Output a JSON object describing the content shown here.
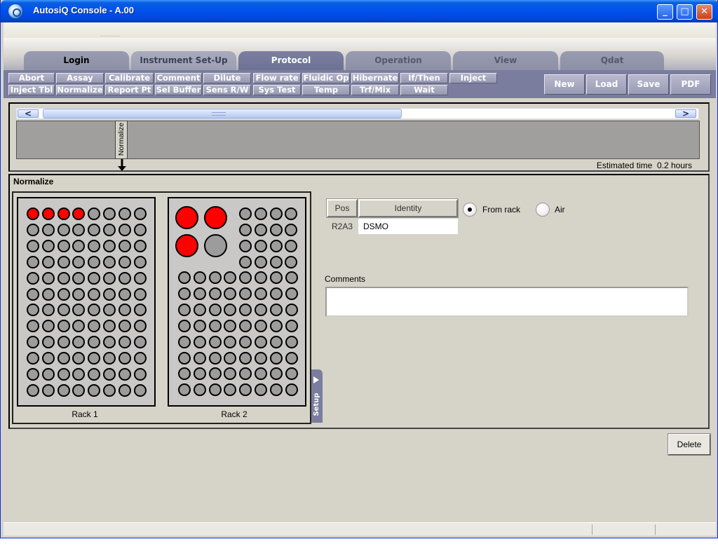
{
  "window": {
    "title": "AutosiQ Console - A.00",
    "minimize": "_",
    "maximize": "□",
    "close": "✕"
  },
  "tabs": [
    {
      "label": "Login"
    },
    {
      "label": "Instrument Set-Up"
    },
    {
      "label": "Protocol"
    },
    {
      "label": "Operation"
    },
    {
      "label": "View"
    },
    {
      "label": "Qdat"
    }
  ],
  "active_tab": "Protocol",
  "toolbar": {
    "row1": [
      "Abort",
      "Assay",
      "Calibrate",
      "Comment",
      "Dilute",
      "Flow rate",
      "Fluidic Op",
      "Hibernate",
      "If/Then",
      "Inject"
    ],
    "row2": [
      "Inject Tbl",
      "Normalize",
      "Report Pt",
      "Sel Buffer",
      "Sens R/W",
      "Sys Test",
      "Temp",
      "Trf/Mix",
      "Wait"
    ],
    "actions": [
      "New",
      "Load",
      "Save",
      "PDF"
    ]
  },
  "timeline": {
    "scroll_left": "<",
    "scroll_right": ">",
    "step_label": "Normalize",
    "estimated_time_label": "Estimated time",
    "estimated_time_value": "0.2 hours"
  },
  "editor": {
    "section_title": "Normalize",
    "rack1_label": "Rack 1",
    "rack2_label": "Rack 2",
    "setup_tab": "Setup",
    "rack1": {
      "rows": 12,
      "cols": 8,
      "red_wells": [
        "A1",
        "A2",
        "A3",
        "A4"
      ]
    },
    "rack2": {
      "large_wells": [
        {
          "pos": "A1",
          "state": "red"
        },
        {
          "pos": "A2",
          "state": "red"
        },
        {
          "pos": "B1",
          "state": "red"
        },
        {
          "pos": "B2",
          "state": "empty"
        }
      ]
    },
    "grid": {
      "headers": [
        "Pos",
        "Identity"
      ],
      "rows": [
        {
          "pos": "R2A3",
          "identity": "DSMO"
        }
      ]
    },
    "source_options": [
      {
        "label": "From rack",
        "checked": true
      },
      {
        "label": "Air",
        "checked": false
      }
    ],
    "comments_label": "Comments",
    "comments_value": "",
    "delete_label": "Delete"
  },
  "colors": {
    "title_bar": "#0050ee",
    "toolbar_bg": "#7a7d9d",
    "well_selected": "#ff0000",
    "well_empty": "#9c9c9c",
    "panel_bg": "#d6d3c8"
  }
}
